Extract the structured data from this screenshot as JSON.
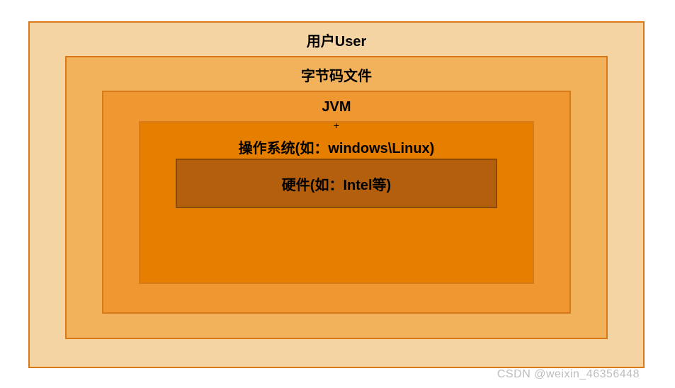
{
  "layers": {
    "user": "用户User",
    "bytecode": "字节码文件",
    "jvm": "JVM",
    "plus": "+",
    "os": "操作系统(如：windows\\Linux)",
    "hardware": "硬件(如：Intel等)"
  },
  "watermark": "CSDN @weixin_46356448"
}
